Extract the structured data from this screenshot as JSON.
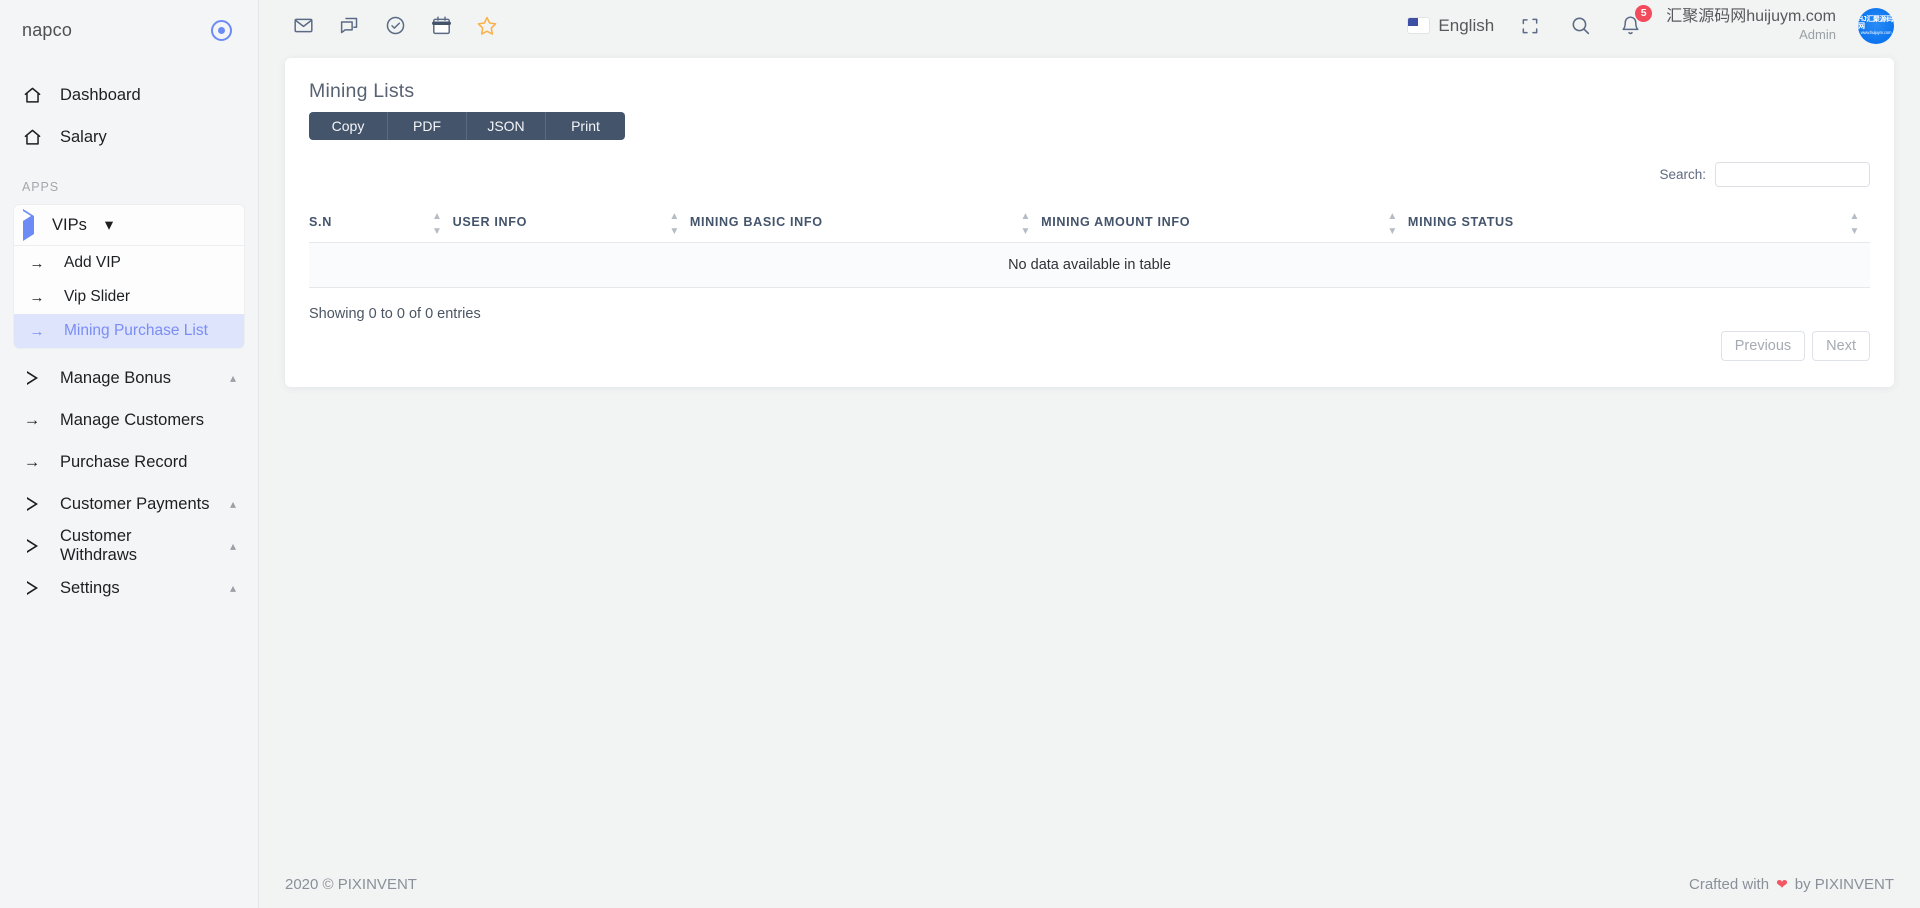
{
  "sidebar": {
    "brand": "napco",
    "brand_icon": "target-dot-icon",
    "top_items": [
      {
        "label": "Dashboard",
        "icon": "home-icon"
      },
      {
        "label": "Salary",
        "icon": "home-icon"
      }
    ],
    "section_label": "APPS",
    "group": {
      "label": "VIPs",
      "icon": "play-triangle-icon",
      "caret": "chevron-down-icon",
      "items": [
        {
          "label": "Add VIP",
          "icon": "arrow-right-icon",
          "active": false
        },
        {
          "label": "Vip Slider",
          "icon": "arrow-right-icon",
          "active": false
        },
        {
          "label": "Mining Purchase List",
          "icon": "arrow-right-icon",
          "active": true
        }
      ]
    },
    "bottom_items": [
      {
        "label": "Manage Bonus",
        "icon": "play-triangle-icon",
        "caret": "chevron-up-icon"
      },
      {
        "label": "Manage Customers",
        "icon": "arrow-right-icon",
        "caret": ""
      },
      {
        "label": "Purchase Record",
        "icon": "arrow-right-icon",
        "caret": ""
      },
      {
        "label": "Customer Payments",
        "icon": "play-triangle-icon",
        "caret": "chevron-up-icon"
      },
      {
        "label": "Customer Withdraws",
        "icon": "play-triangle-icon",
        "caret": "chevron-up-icon"
      },
      {
        "label": "Settings",
        "icon": "play-triangle-icon",
        "caret": "chevron-up-icon"
      }
    ]
  },
  "navbar": {
    "icons": [
      "mail-icon",
      "chat-icon",
      "check-circle-icon",
      "calendar-icon",
      "star-icon"
    ],
    "language": "English",
    "flag": "us-flag-icon",
    "fullscreen_icon": "fullscreen-icon",
    "search_icon": "search-icon",
    "bell_icon": "bell-icon",
    "notification_count": "5",
    "user_name": "汇聚源码网huijuym.com",
    "user_role": "Admin",
    "avatar_line1": "HJ汇聚源码网",
    "avatar_line2": "www.huijuym.com",
    "accent_color": "#0b74ef",
    "badge_color": "#f24b5c"
  },
  "main": {
    "card_title": "Mining Lists",
    "export_buttons": [
      "Copy",
      "PDF",
      "JSON",
      "Print"
    ],
    "search_label": "Search:",
    "search_value": "",
    "search_placeholder": "",
    "table": {
      "columns": [
        "S.N",
        "USER INFO",
        "MINING BASIC INFO",
        "MINING AMOUNT INFO",
        "MINING STATUS"
      ],
      "rows": [],
      "empty_message": "No data available in table"
    },
    "showing_text": "Showing 0 to 0 of 0 entries",
    "previous_label": "Previous",
    "next_label": "Next"
  },
  "footer": {
    "left": "2020 © PIXINVENT",
    "crafted_prefix": "Crafted with",
    "heart_icon": "heart-icon",
    "crafted_suffix": "by PIXINVENT"
  }
}
